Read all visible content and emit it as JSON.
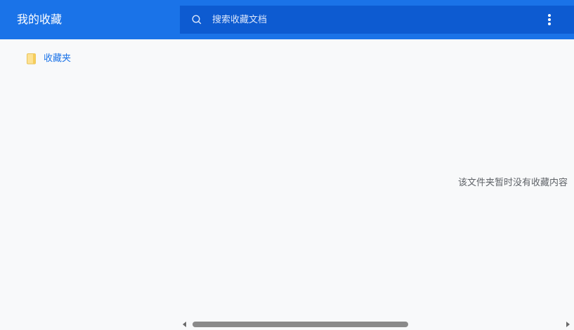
{
  "header": {
    "title": "我的收藏",
    "search": {
      "placeholder": "搜索收藏文档",
      "value": "",
      "icon": "search-icon"
    },
    "menu_icon": "more-vertical-icon"
  },
  "folders": [
    {
      "label": "收藏夹",
      "icon": "folder-icon"
    }
  ],
  "main": {
    "empty_message": "该文件夹暂时没有收藏内容"
  },
  "colors": {
    "header_bg": "#1a73e8",
    "search_bg": "#0d5bd1",
    "link": "#1a73e8",
    "page_bg": "#f8f9fa",
    "folder_yellow": "#fdd663"
  }
}
